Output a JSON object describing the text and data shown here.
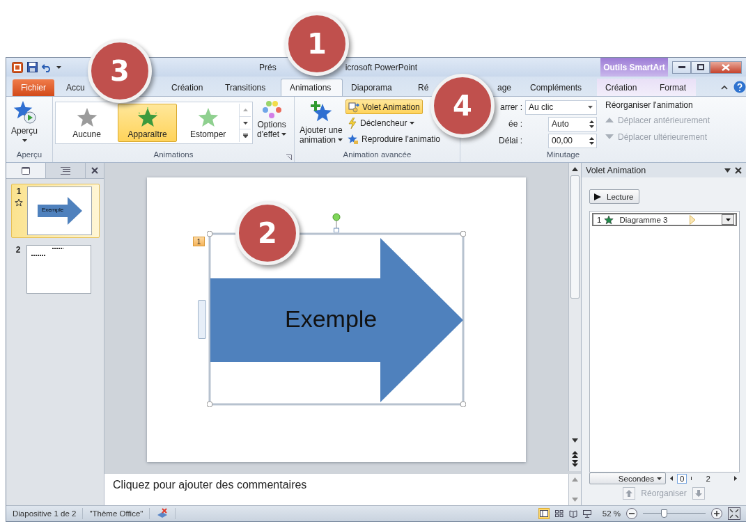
{
  "window": {
    "title_start": "Prés",
    "title_end": "icrosoft PowerPoint",
    "context_tab": "Outils SmartArt"
  },
  "tabs": [
    {
      "label": "Fichier",
      "kind": "file",
      "selected": false
    },
    {
      "label": "Accu",
      "kind": "main",
      "selected": false
    },
    {
      "label": "Création",
      "kind": "main",
      "selected": false
    },
    {
      "label": "Transitions",
      "kind": "main",
      "selected": false
    },
    {
      "label": "Animations",
      "kind": "main",
      "selected": true
    },
    {
      "label": "Diaporama",
      "kind": "main",
      "selected": false
    },
    {
      "label": "Ré",
      "kind": "main",
      "selected": false
    },
    {
      "label": "age",
      "kind": "main",
      "selected": false
    },
    {
      "label": "Compléments",
      "kind": "main",
      "selected": false
    },
    {
      "label": "Création",
      "kind": "context",
      "selected": false
    },
    {
      "label": "Format",
      "kind": "context",
      "selected": false
    }
  ],
  "ribbon": {
    "preview": {
      "label": "Aperçu",
      "group": "Aperçu"
    },
    "animations": {
      "items": [
        {
          "label": "Aucune",
          "kind": "none",
          "selected": false
        },
        {
          "label": "Apparaître",
          "kind": "appear",
          "selected": true
        },
        {
          "label": "Estomper",
          "kind": "fade",
          "selected": false
        }
      ],
      "options_line1": "Options",
      "options_line2": "d'effet",
      "group": "Animations"
    },
    "advanced": {
      "add_line1": "Ajouter une",
      "add_line2": "animation",
      "buttons": [
        {
          "label": "Volet Animation",
          "kind": "pane",
          "on": true
        },
        {
          "label": "Déclencheur",
          "kind": "trigger",
          "on": false
        },
        {
          "label": "Reproduire l'animatio",
          "kind": "painter",
          "on": false
        }
      ],
      "group": "Animation avancée"
    },
    "timing": {
      "fields": [
        {
          "label": "arrer :",
          "value": "Au clic",
          "kind": "dropdown"
        },
        {
          "label": "ée :",
          "value": "Auto",
          "kind": "spinner"
        },
        {
          "label": "Délai :",
          "value": "00,00",
          "kind": "spinner"
        }
      ],
      "reorder_title": "Réorganiser l'animation",
      "reorder": [
        {
          "label": "Déplacer antérieurement",
          "kind": "up",
          "disabled": true
        },
        {
          "label": "Déplacer ultérieurement",
          "kind": "down",
          "disabled": true
        }
      ],
      "group": "Minutage"
    }
  },
  "slides_pane": {
    "thumbnails": [
      {
        "number": "1",
        "text": "Exemple",
        "animated": true,
        "selected": true
      },
      {
        "number": "2",
        "animated": false,
        "selected": false
      }
    ]
  },
  "slide": {
    "shape_text": "Exemple",
    "animation_tag": "1"
  },
  "notes": {
    "prompt": "Cliquez pour ajouter des commentaires"
  },
  "animation_pane": {
    "title": "Volet Animation",
    "play": "Lecture",
    "items": [
      {
        "number": "1",
        "name": "Diagramme 3",
        "selected": true
      }
    ],
    "seconds": "Secondes",
    "timeline": [
      "0",
      "2"
    ],
    "reorder": "Réorganiser"
  },
  "status_bar": {
    "slide": "Diapositive 1 de 2",
    "theme": "\"Thème Office\"",
    "zoom": "52 %",
    "zoom_slider": {
      "level": 0.33
    }
  },
  "callouts": [
    "1",
    "2",
    "3",
    "4"
  ]
}
